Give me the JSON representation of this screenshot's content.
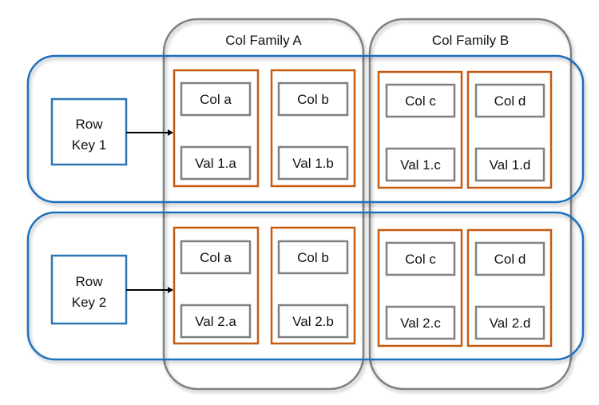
{
  "colors": {
    "row_border": "#1f6fbf",
    "family_border": "#808080",
    "column_border": "#c55a11",
    "cell_border": "#808080",
    "arrow": "#000000",
    "text": "#111111"
  },
  "families": [
    {
      "label": "Col Family A",
      "columns": [
        "a",
        "b"
      ]
    },
    {
      "label": "Col Family B",
      "columns": [
        "c",
        "d"
      ]
    }
  ],
  "rows": [
    {
      "key_line1": "Row",
      "key_line2": "Key 1",
      "cells": [
        {
          "col": "Col a",
          "val": "Val 1.a"
        },
        {
          "col": "Col b",
          "val": "Val 1.b"
        },
        {
          "col": "Col c",
          "val": "Val 1.c"
        },
        {
          "col": "Col d",
          "val": "Val 1.d"
        }
      ]
    },
    {
      "key_line1": "Row",
      "key_line2": "Key 2",
      "cells": [
        {
          "col": "Col a",
          "val": "Val 2.a"
        },
        {
          "col": "Col b",
          "val": "Val 2.b"
        },
        {
          "col": "Col c",
          "val": "Val 2.c"
        },
        {
          "col": "Col d",
          "val": "Val 2.d"
        }
      ]
    }
  ]
}
